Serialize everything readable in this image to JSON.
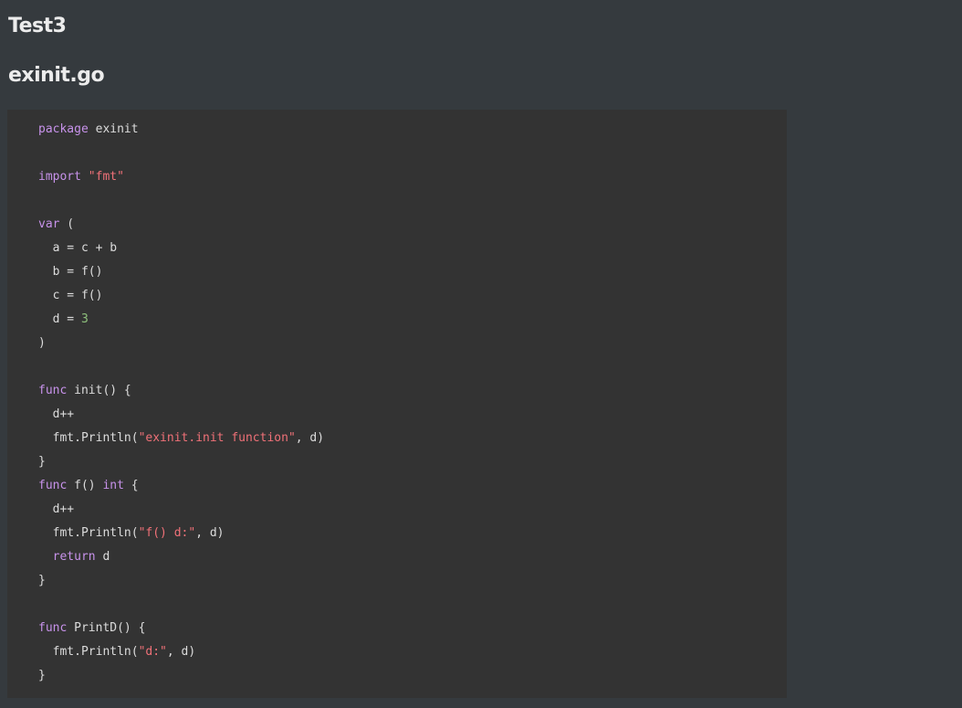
{
  "headings": {
    "title": "Test3",
    "file": "exinit.go"
  },
  "colors": {
    "background": "#353a3e",
    "code_background": "#333333",
    "keyword": "#c792ea",
    "string": "#f07178",
    "number": "#8ec07c",
    "text": "#dcdcdc"
  },
  "code_lines": [
    [
      {
        "t": "kw",
        "v": "package"
      },
      {
        "t": "id",
        "v": " exinit"
      }
    ],
    [],
    [
      {
        "t": "kw",
        "v": "import"
      },
      {
        "t": "id",
        "v": " "
      },
      {
        "t": "str",
        "v": "\"fmt\""
      }
    ],
    [],
    [
      {
        "t": "kw",
        "v": "var"
      },
      {
        "t": "id",
        "v": " ("
      }
    ],
    [
      {
        "t": "id",
        "v": "  a = c + b"
      }
    ],
    [
      {
        "t": "id",
        "v": "  b = f()"
      }
    ],
    [
      {
        "t": "id",
        "v": "  c = f()"
      }
    ],
    [
      {
        "t": "id",
        "v": "  d = "
      },
      {
        "t": "num",
        "v": "3"
      }
    ],
    [
      {
        "t": "id",
        "v": ")"
      }
    ],
    [],
    [
      {
        "t": "kw",
        "v": "func"
      },
      {
        "t": "id",
        "v": " init() {"
      }
    ],
    [
      {
        "t": "id",
        "v": "  d++"
      }
    ],
    [
      {
        "t": "id",
        "v": "  fmt.Println("
      },
      {
        "t": "str",
        "v": "\"exinit.init function\""
      },
      {
        "t": "id",
        "v": ", d)"
      }
    ],
    [
      {
        "t": "id",
        "v": "}"
      }
    ],
    [
      {
        "t": "kw",
        "v": "func"
      },
      {
        "t": "id",
        "v": " f() "
      },
      {
        "t": "kw",
        "v": "int"
      },
      {
        "t": "id",
        "v": " {"
      }
    ],
    [
      {
        "t": "id",
        "v": "  d++"
      }
    ],
    [
      {
        "t": "id",
        "v": "  fmt.Println("
      },
      {
        "t": "str",
        "v": "\"f() d:\""
      },
      {
        "t": "id",
        "v": ", d)"
      }
    ],
    [
      {
        "t": "id",
        "v": "  "
      },
      {
        "t": "kw",
        "v": "return"
      },
      {
        "t": "id",
        "v": " d"
      }
    ],
    [
      {
        "t": "id",
        "v": "}"
      }
    ],
    [],
    [
      {
        "t": "kw",
        "v": "func"
      },
      {
        "t": "id",
        "v": " PrintD() {"
      }
    ],
    [
      {
        "t": "id",
        "v": "  fmt.Println("
      },
      {
        "t": "str",
        "v": "\"d:\""
      },
      {
        "t": "id",
        "v": ", d)"
      }
    ],
    [
      {
        "t": "id",
        "v": "}"
      }
    ]
  ]
}
